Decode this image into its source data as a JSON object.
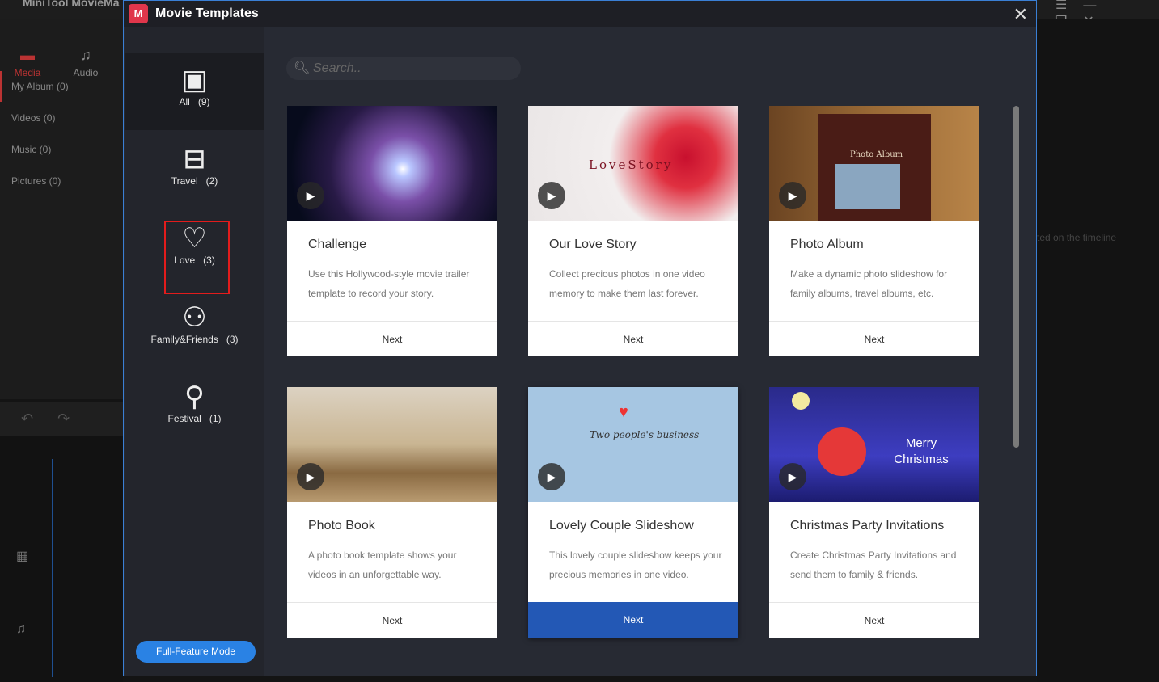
{
  "app": {
    "title": "MiniTool MovieMa",
    "tabs": [
      {
        "label": "Media",
        "icon": "folder-icon"
      },
      {
        "label": "Audio",
        "icon": "music-icon"
      }
    ],
    "albums": [
      "My Album (0)",
      "Videos (0)",
      "Music (0)",
      "Pictures (0)"
    ],
    "hint": "ted on the timeline"
  },
  "dialog": {
    "title": "Movie Templates",
    "search_placeholder": "Search..",
    "categories": [
      {
        "label": "All   (9)",
        "icon": "grid-icon"
      },
      {
        "label": "Travel   (2)",
        "icon": "luggage-icon"
      },
      {
        "label": "Love   (3)",
        "icon": "heart-icon"
      },
      {
        "label": "Family&Friends   (3)",
        "icon": "people-icon"
      },
      {
        "label": "Festival   (1)",
        "icon": "balloon-icon"
      }
    ],
    "full_feature": "Full-Feature Mode",
    "templates": [
      {
        "name": "Challenge",
        "desc": "Use this Hollywood-style movie trailer template to record your story.",
        "next": "Next"
      },
      {
        "name": "Our Love Story",
        "desc": "Collect precious photos in one video memory to make them last forever.",
        "next": "Next",
        "thumb_text": "LoveStory"
      },
      {
        "name": "Photo Album",
        "desc": "Make a dynamic photo slideshow for family albums, travel albums, etc.",
        "next": "Next",
        "thumb_text": "Photo Album"
      },
      {
        "name": "Photo Book",
        "desc": "A photo book template shows your videos in an unforgettable way.",
        "next": "Next"
      },
      {
        "name": "Lovely Couple Slideshow",
        "desc": "This lovely couple slideshow keeps your precious memories in one video.",
        "next": "Next",
        "thumb_text": "Two people's business"
      },
      {
        "name": "Christmas Party Invitations",
        "desc": "Create Christmas Party Invitations and send them to family & friends.",
        "next": "Next",
        "thumb_text": "Merry Christmas"
      }
    ]
  },
  "colors": {
    "accent": "#2a82e4",
    "selected_next": "#2358b5",
    "highlight_box": "#e21c1c"
  }
}
